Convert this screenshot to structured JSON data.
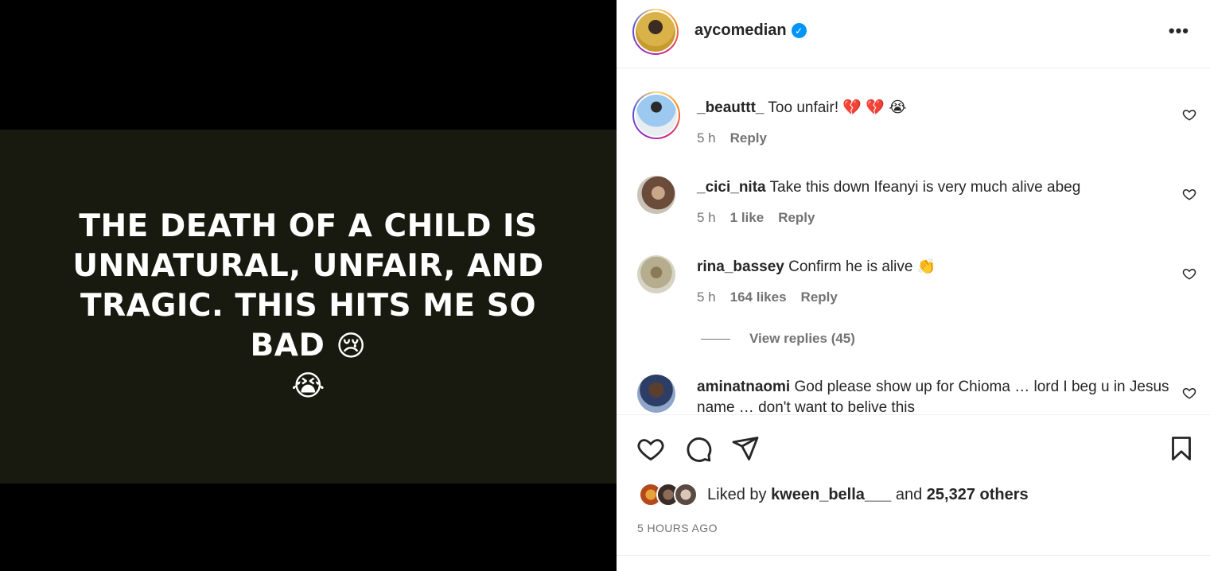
{
  "post": {
    "media_text_lines": [
      "THE DEATH OF A CHILD IS",
      "UNNATURAL, UNFAIR, AND",
      "TRAGIC. THIS HITS ME SO BAD"
    ],
    "media_emoji_1": "😢",
    "media_emoji_2": "😭"
  },
  "header": {
    "username": "aycomedian",
    "verified_icon": "verified-badge-icon",
    "more_label": "•••"
  },
  "comments": [
    {
      "user": "_beauttt_",
      "text": "Too unfair! 💔 💔 😭",
      "time": "5 h",
      "likes": "",
      "reply": "Reply"
    },
    {
      "user": "_cici_nita",
      "text": "Take this down Ifeanyi is very much alive abeg",
      "time": "5 h",
      "likes": "1 like",
      "reply": "Reply"
    },
    {
      "user": "rina_bassey",
      "text": "Confirm he is alive 👏",
      "time": "5 h",
      "likes": "164 likes",
      "reply": "Reply"
    },
    {
      "user": "aminatnaomi",
      "text": "God please show up for Chioma … lord I beg u in Jesus name … don't want to belive this",
      "time": "",
      "likes": "",
      "reply": ""
    }
  ],
  "view_replies": "View replies (45)",
  "likes": {
    "prefix": "Liked by",
    "user": "kween_bella___",
    "and": "and",
    "others": "25,327 others"
  },
  "time_ago": "5 HOURS AGO",
  "colors": {
    "text": "#262626",
    "muted": "#737373",
    "verified": "#0095f6",
    "media_bg": "#191a0f"
  }
}
